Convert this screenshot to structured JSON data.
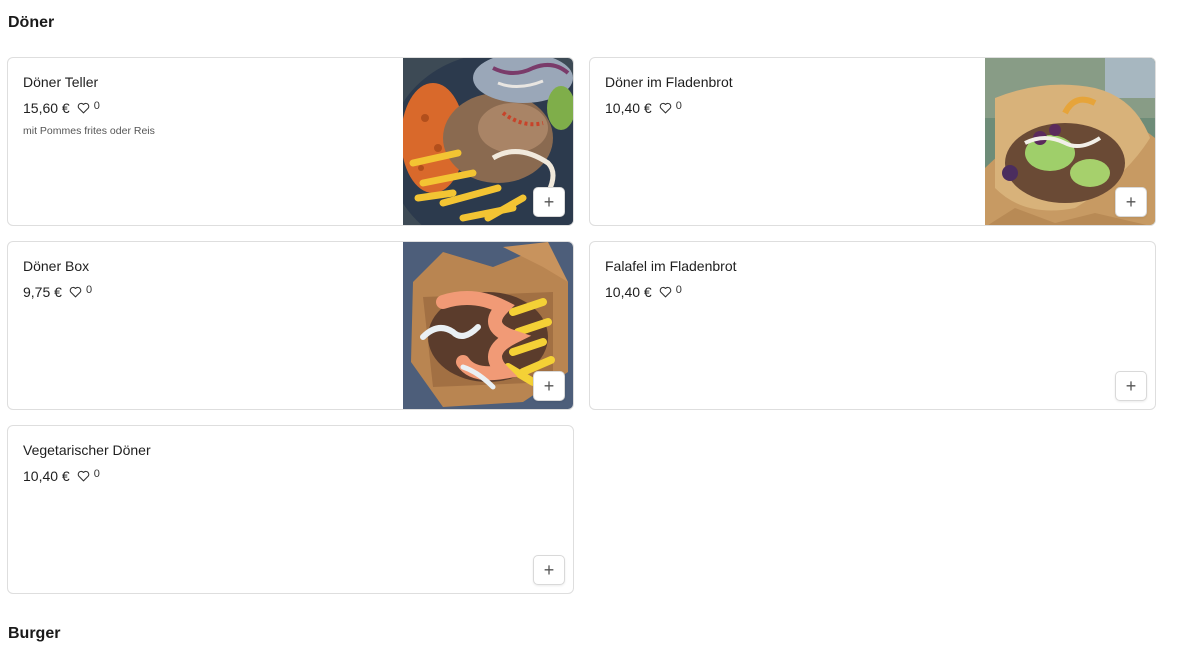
{
  "sections": [
    {
      "title": "Döner",
      "items": [
        {
          "name": "Döner Teller",
          "price": "15,60 €",
          "likes": "0",
          "description": "mit Pommes frites oder Reis",
          "add_label": "+"
        },
        {
          "name": "Döner im Fladenbrot",
          "price": "10,40 €",
          "likes": "0",
          "add_label": "+"
        },
        {
          "name": "Döner Box",
          "price": "9,75 €",
          "likes": "0",
          "add_label": "+"
        },
        {
          "name": "Falafel im Fladenbrot",
          "price": "10,40 €",
          "likes": "0",
          "add_label": "+"
        },
        {
          "name": "Vegetarischer Döner",
          "price": "10,40 €",
          "likes": "0",
          "add_label": "+"
        }
      ]
    },
    {
      "title": "Burger"
    }
  ],
  "icons": {
    "like": "heart-outline-icon",
    "add": "plus-icon"
  }
}
